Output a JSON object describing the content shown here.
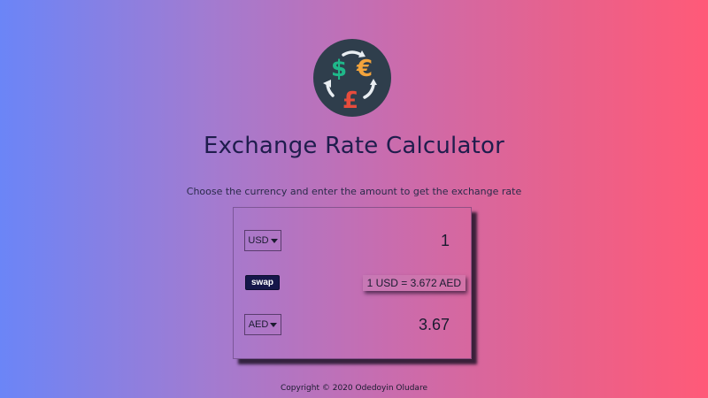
{
  "header": {
    "title": "Exchange Rate Calculator",
    "subtitle": "Choose the currency and enter the amount to get the exchange rate",
    "logo_icon": "currency-exchange-icon"
  },
  "converter": {
    "from": {
      "currency": "USD",
      "amount": "1"
    },
    "to": {
      "currency": "AED",
      "amount": "3.67"
    },
    "swap_label": "swap",
    "rate_text": "1 USD = 3.672 AED"
  },
  "footer": {
    "text": "Copyright © 2020 Odedoyin Oludare"
  },
  "colors": {
    "gradient_start": "#6b85f7",
    "gradient_end": "#ff5a78",
    "title": "#1f1d4d",
    "swap_button": "#16174a"
  }
}
